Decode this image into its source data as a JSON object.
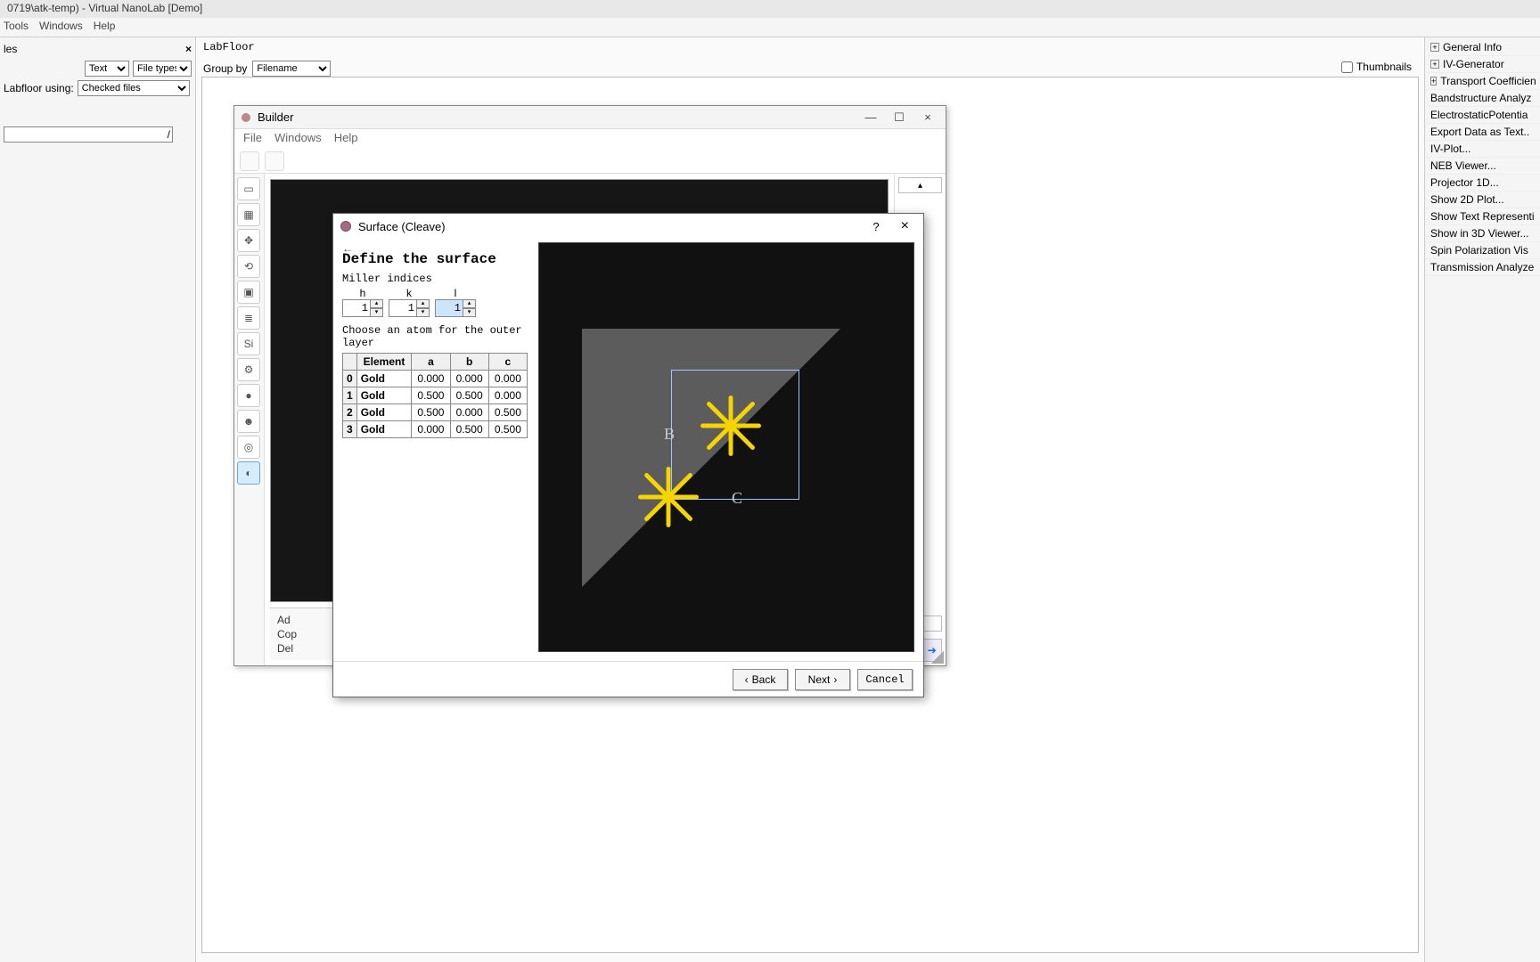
{
  "app": {
    "title": "0719\\atk-temp) - Virtual NanoLab [Demo]"
  },
  "main_menu": {
    "tools": "Tools",
    "windows": "Windows",
    "help": "Help"
  },
  "left_panel": {
    "header": "les",
    "text_label": "Text",
    "filetypes_label": "File types",
    "labfloor_label": "Labfloor using:",
    "checked_files": "Checked files",
    "path_suffix": "/"
  },
  "labfloor": {
    "label": "LabFloor",
    "groupby": "Group by",
    "filename": "Filename",
    "thumbnails": "Thumbnails"
  },
  "right_panel": {
    "items": [
      {
        "label": "General Info",
        "exp": true
      },
      {
        "label": "IV-Generator",
        "exp": true
      },
      {
        "label": "Transport Coefficien",
        "exp": true
      },
      {
        "label": "Bandstructure Analyz",
        "exp": false
      },
      {
        "label": "ElectrostaticPotentia",
        "exp": false
      },
      {
        "label": "Export Data as Text..",
        "exp": false
      },
      {
        "label": "IV-Plot...",
        "exp": false
      },
      {
        "label": "NEB Viewer...",
        "exp": false
      },
      {
        "label": "Projector 1D...",
        "exp": false
      },
      {
        "label": "Show 2D Plot...",
        "exp": false
      },
      {
        "label": "Show Text Representi",
        "exp": false
      },
      {
        "label": "Show in 3D Viewer...",
        "exp": false
      },
      {
        "label": "Spin Polarization Vis",
        "exp": false
      },
      {
        "label": "Transmission Analyze",
        "exp": false
      }
    ]
  },
  "builder": {
    "title": "Builder",
    "menu": {
      "file": "File",
      "windows": "Windows",
      "help": "Help"
    },
    "stash": {
      "add": "Ad",
      "copy": "Cop",
      "del": "Del"
    }
  },
  "surface": {
    "title": "Surface (Cleave)",
    "heading": "Define the surface",
    "miller_label": "Miller indices",
    "h": "h",
    "k": "k",
    "l": "l",
    "hval": "1",
    "kval": "1",
    "lval": "1",
    "choose": "Choose an atom for the outer layer",
    "cols": {
      "element": "Element",
      "a": "a",
      "b": "b",
      "c": "c"
    },
    "rows": [
      {
        "i": "0",
        "el": "Gold",
        "a": "0.000",
        "b": "0.000",
        "c": "0.000"
      },
      {
        "i": "1",
        "el": "Gold",
        "a": "0.500",
        "b": "0.500",
        "c": "0.000"
      },
      {
        "i": "2",
        "el": "Gold",
        "a": "0.500",
        "b": "0.000",
        "c": "0.500"
      },
      {
        "i": "3",
        "el": "Gold",
        "a": "0.000",
        "b": "0.500",
        "c": "0.500"
      }
    ],
    "axis_b": "B",
    "axis_c": "C",
    "back": "Back",
    "next": "Next",
    "cancel": "Cancel",
    "help": "?",
    "close": "×"
  }
}
